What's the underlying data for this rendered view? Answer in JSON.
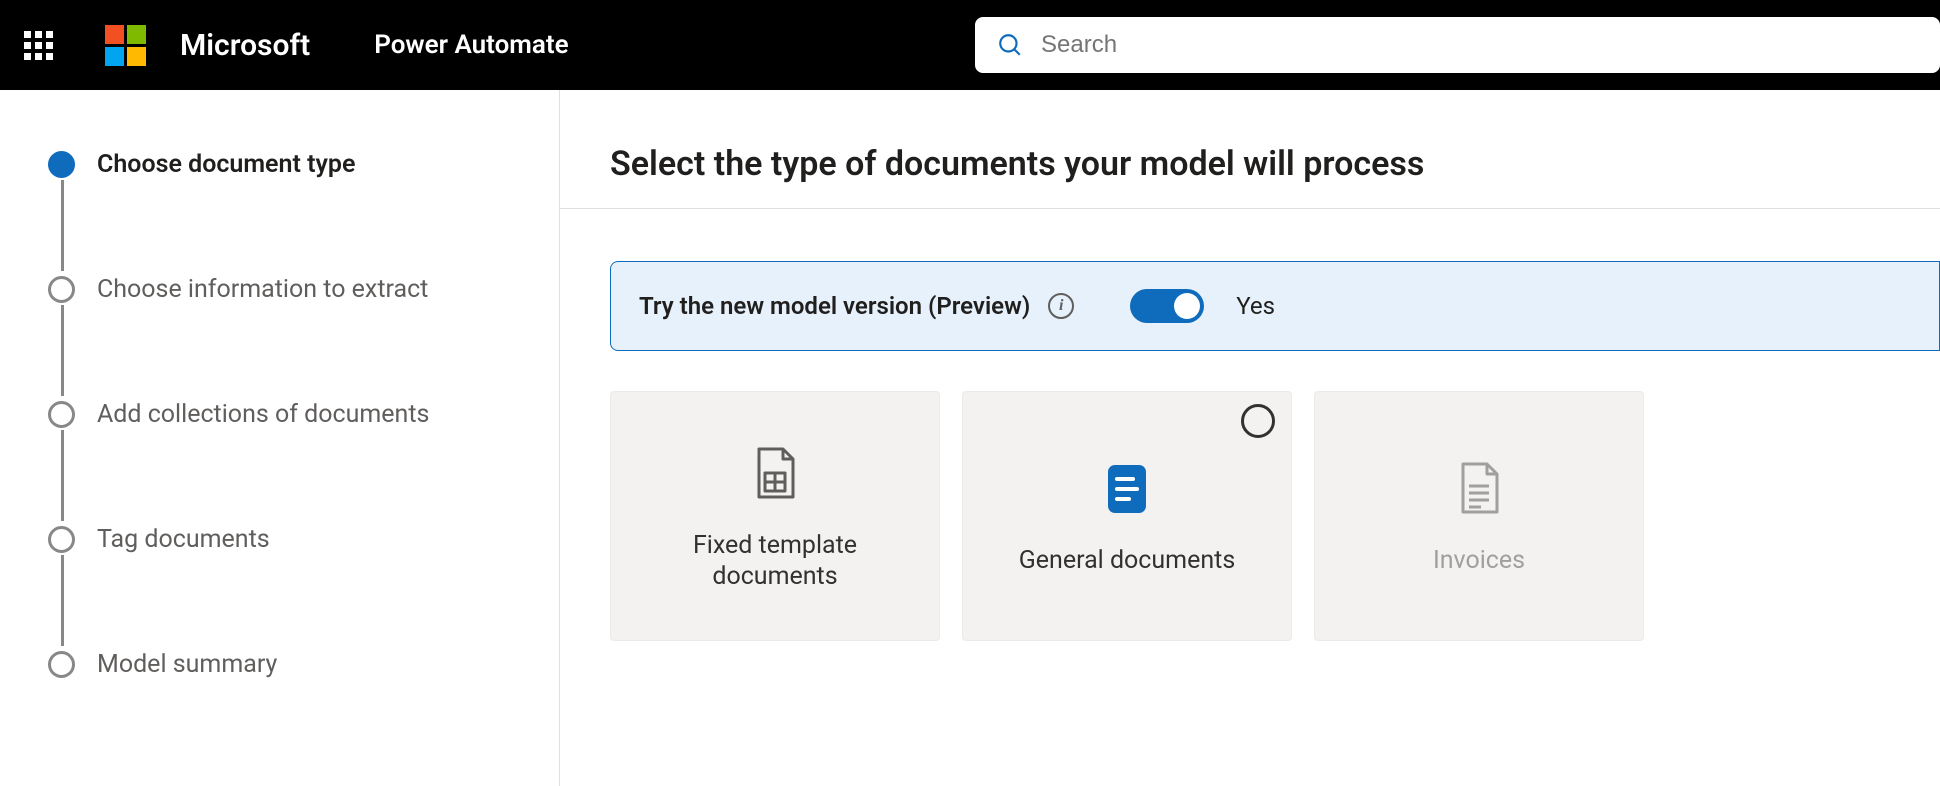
{
  "header": {
    "brand": "Microsoft",
    "app_name": "Power Automate",
    "search_placeholder": "Search"
  },
  "steps": [
    {
      "label": "Choose document type",
      "active": true
    },
    {
      "label": "Choose information to extract",
      "active": false
    },
    {
      "label": "Add collections of documents",
      "active": false
    },
    {
      "label": "Tag documents",
      "active": false
    },
    {
      "label": "Model summary",
      "active": false
    }
  ],
  "page_title": "Select the type of documents your model will process",
  "banner": {
    "text": "Try the new model version (Preview)",
    "toggle_on": true,
    "toggle_label": "Yes"
  },
  "cards": [
    {
      "label": "Fixed template documents",
      "kind": "fixed",
      "selectable_marker": false
    },
    {
      "label": "General documents",
      "kind": "general",
      "selectable_marker": true
    },
    {
      "label": "Invoices",
      "kind": "invoices",
      "selectable_marker": false,
      "muted": true
    }
  ]
}
